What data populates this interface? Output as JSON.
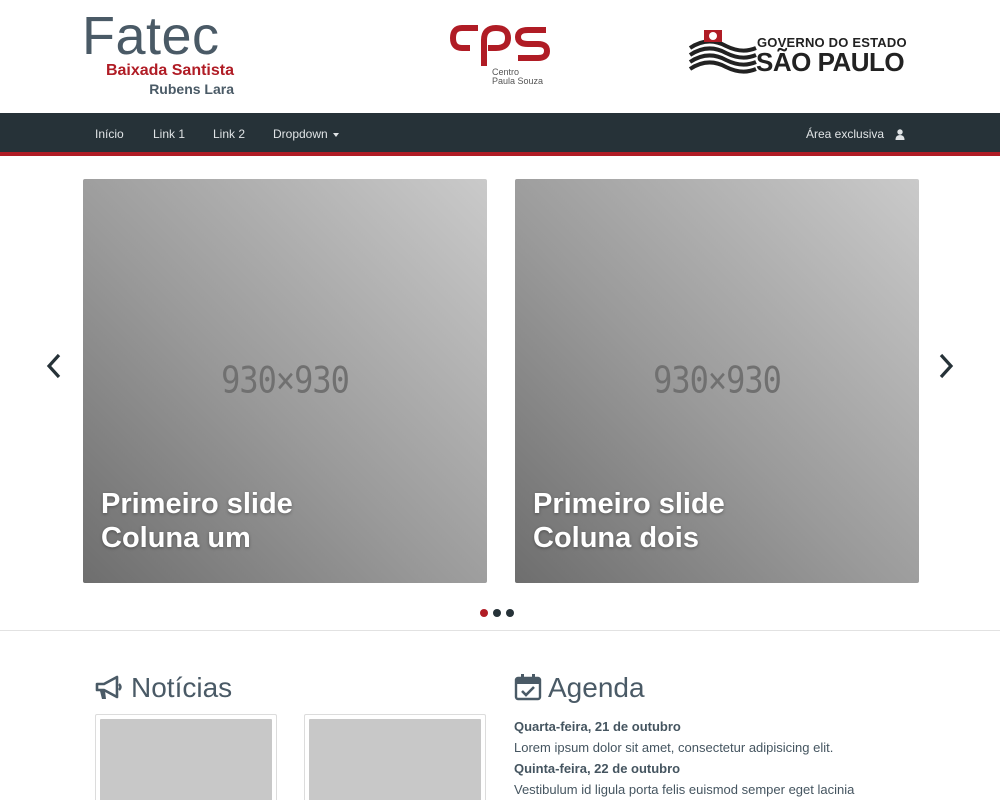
{
  "header": {
    "fatec": {
      "brand": "Fatec",
      "line1": "Baixada Santista",
      "line2": "Rubens Lara"
    },
    "cps": {
      "mark": "cps",
      "line1": "Centro",
      "line2": "Paula Souza"
    },
    "sp": {
      "line1": "GOVERNO DO ESTADO",
      "line2": "SÃO PAULO"
    }
  },
  "navbar": {
    "items": [
      {
        "label": "Início"
      },
      {
        "label": "Link 1"
      },
      {
        "label": "Link 2"
      },
      {
        "label": "Dropdown"
      }
    ],
    "exclusive_label": "Área exclusiva"
  },
  "carousel": {
    "slides": [
      {
        "placeholder": "930×930",
        "caption_line1": "Primeiro slide",
        "caption_line2": "Coluna um"
      },
      {
        "placeholder": "930×930",
        "caption_line1": "Primeiro slide",
        "caption_line2": "Coluna dois"
      }
    ],
    "indicator_count": 3,
    "active_indicator": 1,
    "prev_icon": "chevron-left-icon",
    "next_icon": "chevron-right-icon"
  },
  "news": {
    "title": "Notícias",
    "icon": "megaphone-icon"
  },
  "agenda": {
    "title": "Agenda",
    "icon": "calendar-check-icon",
    "entries": [
      {
        "date": "Quarta-feira, 21 de outubro",
        "text": "Lorem ipsum dolor sit amet, consectetur adipisicing elit."
      },
      {
        "date": "Quinta-feira, 22 de outubro",
        "text": "Vestibulum id ligula porta felis euismod semper eget lacinia"
      }
    ]
  },
  "colors": {
    "brand_red": "#b01c25",
    "navbar": "#263238",
    "text": "#4a5a66"
  }
}
